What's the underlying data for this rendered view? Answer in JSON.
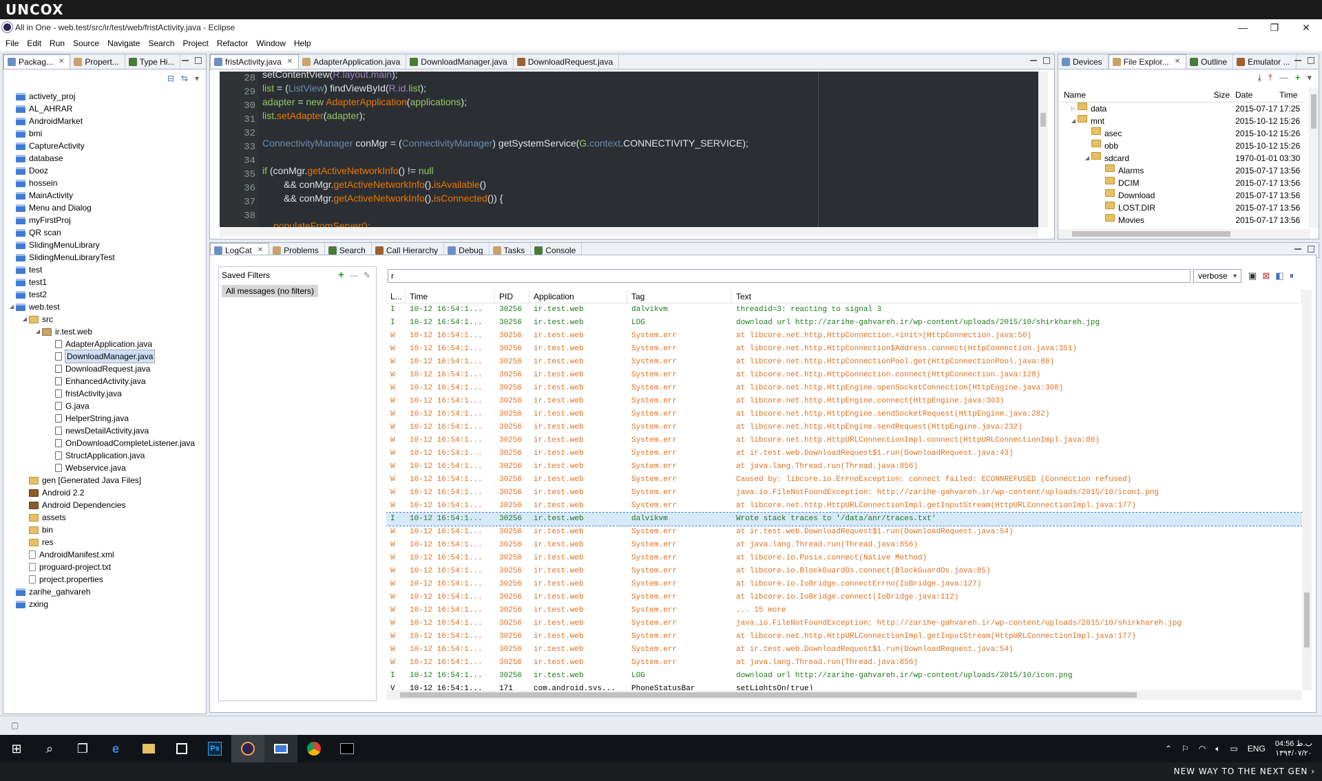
{
  "brand": "UNCOX",
  "window": {
    "title": "All in One - web.test/src/ir/test/web/fristActivity.java - Eclipse",
    "minimize": "—",
    "restore": "❐",
    "close": "✕"
  },
  "menu": [
    "File",
    "Edit",
    "Run",
    "Source",
    "Navigate",
    "Search",
    "Project",
    "Refactor",
    "Window",
    "Help"
  ],
  "left_tabs": [
    "Packag...",
    "Propert...",
    "Type Hi..."
  ],
  "package_tree": [
    {
      "label": "activety_proj",
      "type": "proj",
      "indent": 0,
      "arrow": ""
    },
    {
      "label": "AL_AHRAR",
      "type": "proj",
      "indent": 0,
      "arrow": ""
    },
    {
      "label": "AndroidMarket",
      "type": "proj",
      "indent": 0,
      "arrow": ""
    },
    {
      "label": "bmi",
      "type": "proj",
      "indent": 0,
      "arrow": ""
    },
    {
      "label": "CaptureActivity",
      "type": "proj",
      "indent": 0,
      "arrow": ""
    },
    {
      "label": "database",
      "type": "proj",
      "indent": 0,
      "arrow": ""
    },
    {
      "label": "Dooz",
      "type": "proj",
      "indent": 0,
      "arrow": ""
    },
    {
      "label": "hossein",
      "type": "proj",
      "indent": 0,
      "arrow": ""
    },
    {
      "label": "MainActivity",
      "type": "proj",
      "indent": 0,
      "arrow": ""
    },
    {
      "label": "Menu and Dialog",
      "type": "proj",
      "indent": 0,
      "arrow": ""
    },
    {
      "label": "myFirstProj",
      "type": "proj",
      "indent": 0,
      "arrow": ""
    },
    {
      "label": "QR scan",
      "type": "proj",
      "indent": 0,
      "arrow": ""
    },
    {
      "label": "SlidingMenuLibrary",
      "type": "proj",
      "indent": 0,
      "arrow": ""
    },
    {
      "label": "SlidingMenuLibraryTest",
      "type": "proj",
      "indent": 0,
      "arrow": ""
    },
    {
      "label": "test",
      "type": "proj",
      "indent": 0,
      "arrow": ""
    },
    {
      "label": "test1",
      "type": "proj",
      "indent": 0,
      "arrow": ""
    },
    {
      "label": "test2",
      "type": "proj",
      "indent": 0,
      "arrow": ""
    },
    {
      "label": "web.test",
      "type": "proj",
      "indent": 0,
      "arrow": "◢"
    },
    {
      "label": "src",
      "type": "folder",
      "indent": 1,
      "arrow": "◢"
    },
    {
      "label": "ir.test.web",
      "type": "pkg",
      "indent": 2,
      "arrow": "◢"
    },
    {
      "label": "AdapterApplication.java",
      "type": "jfile",
      "indent": 3,
      "arrow": ""
    },
    {
      "label": "DownloadManager.java",
      "type": "jfile",
      "indent": 3,
      "arrow": "",
      "selected": true
    },
    {
      "label": "DownloadRequest.java",
      "type": "jfile",
      "indent": 3,
      "arrow": ""
    },
    {
      "label": "EnhancedActivity.java",
      "type": "jfile",
      "indent": 3,
      "arrow": ""
    },
    {
      "label": "fristActivity.java",
      "type": "jfile",
      "indent": 3,
      "arrow": ""
    },
    {
      "label": "G.java",
      "type": "jfile",
      "indent": 3,
      "arrow": ""
    },
    {
      "label": "HelperString.java",
      "type": "jfile",
      "indent": 3,
      "arrow": ""
    },
    {
      "label": "newsDetailActivity.java",
      "type": "jfile",
      "indent": 3,
      "arrow": ""
    },
    {
      "label": "OnDownloadCompleteListener.java",
      "type": "jfile",
      "indent": 3,
      "arrow": ""
    },
    {
      "label": "StructApplication.java",
      "type": "jfile",
      "indent": 3,
      "arrow": ""
    },
    {
      "label": "Webservice.java",
      "type": "jfile",
      "indent": 3,
      "arrow": ""
    },
    {
      "label": "gen [Generated Java Files]",
      "type": "folder",
      "indent": 1,
      "arrow": ""
    },
    {
      "label": "Android 2.2",
      "type": "libicon",
      "indent": 1,
      "arrow": ""
    },
    {
      "label": "Android Dependencies",
      "type": "libicon",
      "indent": 1,
      "arrow": ""
    },
    {
      "label": "assets",
      "type": "folder",
      "indent": 1,
      "arrow": ""
    },
    {
      "label": "bin",
      "type": "folder",
      "indent": 1,
      "arrow": ""
    },
    {
      "label": "res",
      "type": "folder",
      "indent": 1,
      "arrow": ""
    },
    {
      "label": "AndroidManifest.xml",
      "type": "txtfile",
      "indent": 1,
      "arrow": ""
    },
    {
      "label": "proguard-project.txt",
      "type": "txtfile",
      "indent": 1,
      "arrow": ""
    },
    {
      "label": "project.properties",
      "type": "txtfile",
      "indent": 1,
      "arrow": ""
    },
    {
      "label": "zarihe_gahvareh",
      "type": "proj",
      "indent": 0,
      "arrow": ""
    },
    {
      "label": "zxing",
      "type": "proj",
      "indent": 0,
      "arrow": ""
    }
  ],
  "editor_tabs": [
    "fristActivity.java",
    "AdapterApplication.java",
    "DownloadManager.java",
    "DownloadRequest.java"
  ],
  "code": {
    "line_numbers": [
      "28",
      "29",
      "30",
      "31",
      "32",
      "33",
      "34",
      "35",
      "36",
      "37",
      "38"
    ],
    "lines": [
      [
        {
          "t": "setContentView(",
          "c": ""
        },
        {
          "t": "R.layout.main",
          "c": "f"
        },
        {
          "t": ");",
          "c": ""
        }
      ],
      [
        {
          "t": "list",
          "c": "k"
        },
        {
          "t": " = (",
          "c": ""
        },
        {
          "t": "ListView",
          "c": "t"
        },
        {
          "t": ") findViewById(",
          "c": ""
        },
        {
          "t": "R.id.",
          "c": "f"
        },
        {
          "t": "list",
          "c": "k"
        },
        {
          "t": ");",
          "c": ""
        }
      ],
      [
        {
          "t": "adapter",
          "c": "k"
        },
        {
          "t": " = ",
          "c": ""
        },
        {
          "t": "new",
          "c": "k"
        },
        {
          "t": " ",
          "c": ""
        },
        {
          "t": "AdapterApplication",
          "c": "s"
        },
        {
          "t": "(",
          "c": ""
        },
        {
          "t": "applications",
          "c": "k"
        },
        {
          "t": ");",
          "c": ""
        }
      ],
      [
        {
          "t": "list",
          "c": "k"
        },
        {
          "t": ".",
          "c": ""
        },
        {
          "t": "setAdapter",
          "c": "s"
        },
        {
          "t": "(",
          "c": ""
        },
        {
          "t": "adapter",
          "c": "k"
        },
        {
          "t": ");",
          "c": ""
        }
      ],
      [],
      [
        {
          "t": "ConnectivityManager",
          "c": "t"
        },
        {
          "t": " conMgr = (",
          "c": ""
        },
        {
          "t": "ConnectivityManager",
          "c": "t"
        },
        {
          "t": ") getSystemService(",
          "c": ""
        },
        {
          "t": "G.",
          "c": "k"
        },
        {
          "t": "context",
          "c": "t"
        },
        {
          "t": ".CONNECTIVITY_SERVICE);",
          "c": ""
        }
      ],
      [],
      [
        {
          "t": "if",
          "c": "k"
        },
        {
          "t": " (conMgr.",
          "c": ""
        },
        {
          "t": "getActiveNetworkInfo",
          "c": "s"
        },
        {
          "t": "() != ",
          "c": ""
        },
        {
          "t": "null",
          "c": "k"
        }
      ],
      [
        {
          "t": "        && conMgr.",
          "c": ""
        },
        {
          "t": "getActiveNetworkInfo",
          "c": "s"
        },
        {
          "t": "().",
          "c": ""
        },
        {
          "t": "isAvailable",
          "c": "s"
        },
        {
          "t": "()",
          "c": ""
        }
      ],
      [
        {
          "t": "        && conMgr.",
          "c": ""
        },
        {
          "t": "getActiveNetworkInfo",
          "c": "s"
        },
        {
          "t": "().",
          "c": ""
        },
        {
          "t": "isConnected",
          "c": "s"
        },
        {
          "t": "()) {",
          "c": ""
        }
      ],
      []
    ],
    "partial_line": "populateFromServer();"
  },
  "right_tabs": [
    "Devices",
    "File Explor...",
    "Outline",
    "Emulator ..."
  ],
  "file_explorer": {
    "headers": [
      "Name",
      "Size",
      "Date",
      "Time"
    ],
    "rows": [
      {
        "name": "data",
        "indent": 1,
        "arrow": "▷",
        "date": "2015-07-17",
        "time": "17:25"
      },
      {
        "name": "mnt",
        "indent": 1,
        "arrow": "◢",
        "date": "2015-10-12",
        "time": "15:26"
      },
      {
        "name": "asec",
        "indent": 2,
        "arrow": "",
        "date": "2015-10-12",
        "time": "15:26"
      },
      {
        "name": "obb",
        "indent": 2,
        "arrow": "",
        "date": "2015-10-12",
        "time": "15:26"
      },
      {
        "name": "sdcard",
        "indent": 2,
        "arrow": "◢",
        "date": "1970-01-01",
        "time": "03:30"
      },
      {
        "name": "Alarms",
        "indent": 3,
        "arrow": "",
        "date": "2015-07-17",
        "time": "13:56"
      },
      {
        "name": "DCIM",
        "indent": 3,
        "arrow": "",
        "date": "2015-07-17",
        "time": "13:56"
      },
      {
        "name": "Download",
        "indent": 3,
        "arrow": "",
        "date": "2015-07-17",
        "time": "13:56"
      },
      {
        "name": "LOST.DIR",
        "indent": 3,
        "arrow": "",
        "date": "2015-07-17",
        "time": "13:56"
      },
      {
        "name": "Movies",
        "indent": 3,
        "arrow": "",
        "date": "2015-07-17",
        "time": "13:56"
      }
    ]
  },
  "bottom_tabs": [
    "LogCat",
    "Problems",
    "Search",
    "Call Hierarchy",
    "Debug",
    "Tasks",
    "Console"
  ],
  "logcat": {
    "saved_filters_label": "Saved Filters",
    "filter_item": "All messages (no filters)",
    "search_value": "r",
    "level_select": "verbose",
    "headers": [
      "L...",
      "Time",
      "PID",
      "Application",
      "Tag",
      "Text"
    ],
    "rows": [
      [
        "I",
        "10-12 16:54:1...",
        "30256",
        "ir.test.web",
        "dalvikvm",
        "threadid=3: reacting to signal 3"
      ],
      [
        "I",
        "10-12 16:54:1...",
        "30256",
        "ir.test.web",
        "LOG",
        "download url http://zarihe-gahvareh.ir/wp-content/uploads/2015/10/shirkhareh.jpg"
      ],
      [
        "W",
        "10-12 16:54:1...",
        "30256",
        "ir.test.web",
        "System.err",
        "at libcore.net.http.HttpConnection.<init>(HttpConnection.java:50)"
      ],
      [
        "W",
        "10-12 16:54:1...",
        "30256",
        "ir.test.web",
        "System.err",
        "at libcore.net.http.HttpConnection$Address.connect(HttpConnection.java:351)"
      ],
      [
        "W",
        "10-12 16:54:1...",
        "30256",
        "ir.test.web",
        "System.err",
        "at libcore.net.http.HttpConnectionPool.get(HttpConnectionPool.java:86)"
      ],
      [
        "W",
        "10-12 16:54:1...",
        "30256",
        "ir.test.web",
        "System.err",
        "at libcore.net.http.HttpConnection.connect(HttpConnection.java:128)"
      ],
      [
        "W",
        "10-12 16:54:1...",
        "30256",
        "ir.test.web",
        "System.err",
        "at libcore.net.http.HttpEngine.openSocketConnection(HttpEngine.java:308)"
      ],
      [
        "W",
        "10-12 16:54:1...",
        "30256",
        "ir.test.web",
        "System.err",
        "at libcore.net.http.HttpEngine.connect(HttpEngine.java:303)"
      ],
      [
        "W",
        "10-12 16:54:1...",
        "30256",
        "ir.test.web",
        "System.err",
        "at libcore.net.http.HttpEngine.sendSocketRequest(HttpEngine.java:282)"
      ],
      [
        "W",
        "10-12 16:54:1...",
        "30256",
        "ir.test.web",
        "System.err",
        "at libcore.net.http.HttpEngine.sendRequest(HttpEngine.java:232)"
      ],
      [
        "W",
        "10-12 16:54:1...",
        "30256",
        "ir.test.web",
        "System.err",
        "at libcore.net.http.HttpURLConnectionImpl.connect(HttpURLConnectionImpl.java:80)"
      ],
      [
        "W",
        "10-12 16:54:1...",
        "30256",
        "ir.test.web",
        "System.err",
        "at ir.test.web.DownloadRequest$1.run(DownloadRequest.java:43)"
      ],
      [
        "W",
        "10-12 16:54:1...",
        "30256",
        "ir.test.web",
        "System.err",
        "at java.lang.Thread.run(Thread.java:856)"
      ],
      [
        "W",
        "10-12 16:54:1...",
        "30256",
        "ir.test.web",
        "System.err",
        "Caused by: libcore.io.ErrnoException: connect failed: ECONNREFUSED (Connection refused)"
      ],
      [
        "W",
        "10-12 16:54:1...",
        "30256",
        "ir.test.web",
        "System.err",
        "java.io.FileNotFoundException: http://zarihe-gahvareh.ir/wp-content/uploads/2015/10/icon1.png"
      ],
      [
        "W",
        "10-12 16:54:1...",
        "30256",
        "ir.test.web",
        "System.err",
        "at libcore.net.http.HttpURLConnectionImpl.getInputStream(HttpURLConnectionImpl.java:177)"
      ],
      [
        "I",
        "10-12 16:54:1...",
        "30256",
        "ir.test.web",
        "dalvikvm",
        "Wrote stack traces to '/data/anr/traces.txt'"
      ],
      [
        "W",
        "10-12 16:54:1...",
        "30256",
        "ir.test.web",
        "System.err",
        "at ir.test.web.DownloadRequest$1.run(DownloadRequest.java:54)"
      ],
      [
        "W",
        "10-12 16:54:1...",
        "30256",
        "ir.test.web",
        "System.err",
        "at java.lang.Thread.run(Thread.java:856)"
      ],
      [
        "W",
        "10-12 16:54:1...",
        "30256",
        "ir.test.web",
        "System.err",
        "at libcore.io.Posix.connect(Native Method)"
      ],
      [
        "W",
        "10-12 16:54:1...",
        "30256",
        "ir.test.web",
        "System.err",
        "at libcore.io.BlockGuardOs.connect(BlockGuardOs.java:85)"
      ],
      [
        "W",
        "10-12 16:54:1...",
        "30256",
        "ir.test.web",
        "System.err",
        "at libcore.io.IoBridge.connectErrno(IoBridge.java:127)"
      ],
      [
        "W",
        "10-12 16:54:1...",
        "30256",
        "ir.test.web",
        "System.err",
        "at libcore.io.IoBridge.connect(IoBridge.java:112)"
      ],
      [
        "W",
        "10-12 16:54:1...",
        "30256",
        "ir.test.web",
        "System.err",
        "... 15 more"
      ],
      [
        "W",
        "10-12 16:54:1...",
        "30256",
        "ir.test.web",
        "System.err",
        "java.io.FileNotFoundException: http://zarihe-gahvareh.ir/wp-content/uploads/2015/10/shirkhareh.jpg"
      ],
      [
        "W",
        "10-12 16:54:1...",
        "30256",
        "ir.test.web",
        "System.err",
        "at libcore.net.http.HttpURLConnectionImpl.getInputStream(HttpURLConnectionImpl.java:177)"
      ],
      [
        "W",
        "10-12 16:54:1...",
        "30256",
        "ir.test.web",
        "System.err",
        "at ir.test.web.DownloadRequest$1.run(DownloadRequest.java:54)"
      ],
      [
        "W",
        "10-12 16:54:1...",
        "30256",
        "ir.test.web",
        "System.err",
        "at java.lang.Thread.run(Thread.java:856)"
      ],
      [
        "I",
        "10-12 16:54:1...",
        "30256",
        "ir.test.web",
        "LOG",
        "download url http://zarihe-gahvareh.ir/wp-content/uploads/2015/10/icon.png"
      ],
      [
        "V",
        "10-12 16:54:1...",
        "171",
        "com.android.sys...",
        "PhoneStatusBar",
        "setLightsOn(true)"
      ]
    ],
    "selected_row": 16
  },
  "taskbar": {
    "tray_lang": "ENG",
    "clock_time": "04:56 ب.ظ",
    "clock_date": "۱۳۹۴/۰۷/۲۰"
  },
  "footer": "NEW WAY TO THE NEXT GEN ›",
  "colors": {
    "warn": "#e0701e",
    "info": "#1c7a1c",
    "editor_bg": "#2b2f33"
  }
}
